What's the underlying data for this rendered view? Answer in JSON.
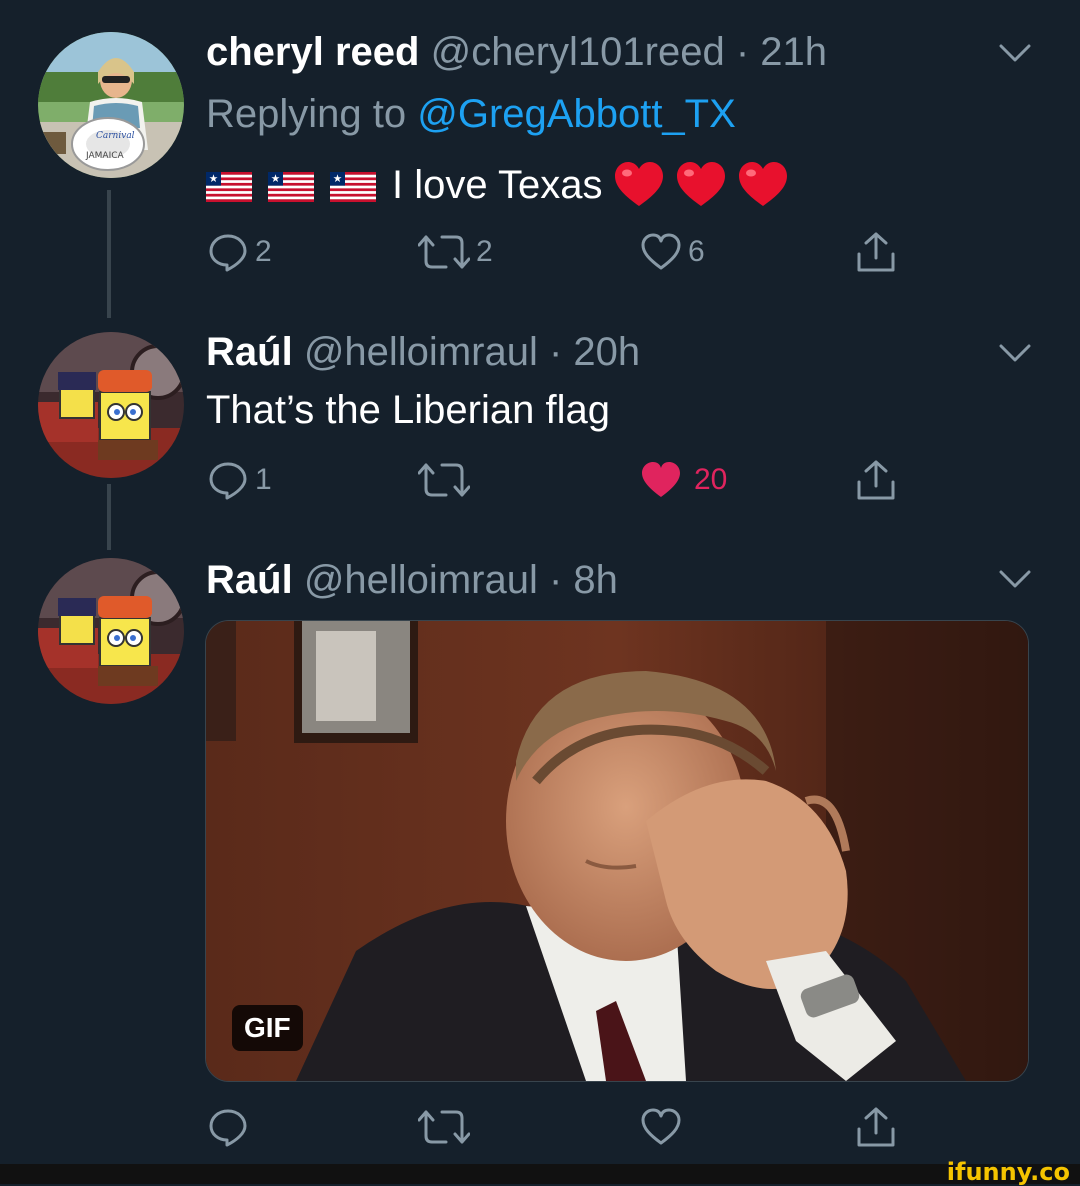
{
  "tweets": [
    {
      "name": "cheryl reed",
      "handle": "@cheryl101reed",
      "separator": "·",
      "time": "21h",
      "replying_prefix": "Replying to",
      "replying_to": "@GregAbbott_TX",
      "text": "I love Texas",
      "flag_emoji_count": 3,
      "heart_emoji_count": 3,
      "reply_count": "2",
      "retweet_count": "2",
      "like_count": "6",
      "liked": false
    },
    {
      "name": "Raúl",
      "handle": "@helloimraul",
      "separator": "·",
      "time": "20h",
      "text": "That’s the Liberian flag",
      "reply_count": "1",
      "retweet_count": "",
      "like_count": "20",
      "liked": true
    },
    {
      "name": "Raúl",
      "handle": "@helloimraul",
      "separator": "·",
      "time": "8h",
      "media_badge": "GIF",
      "reply_count": "",
      "retweet_count": "",
      "like_count": "",
      "liked": false
    }
  ],
  "watermark": "ifunny.co",
  "colors": {
    "background": "#15202b",
    "secondary_text": "#8899a6",
    "link": "#1da1f2",
    "like_active": "#e0245e"
  },
  "icons": [
    "reply-icon",
    "retweet-icon",
    "like-icon",
    "share-icon",
    "chevron-down-icon"
  ]
}
